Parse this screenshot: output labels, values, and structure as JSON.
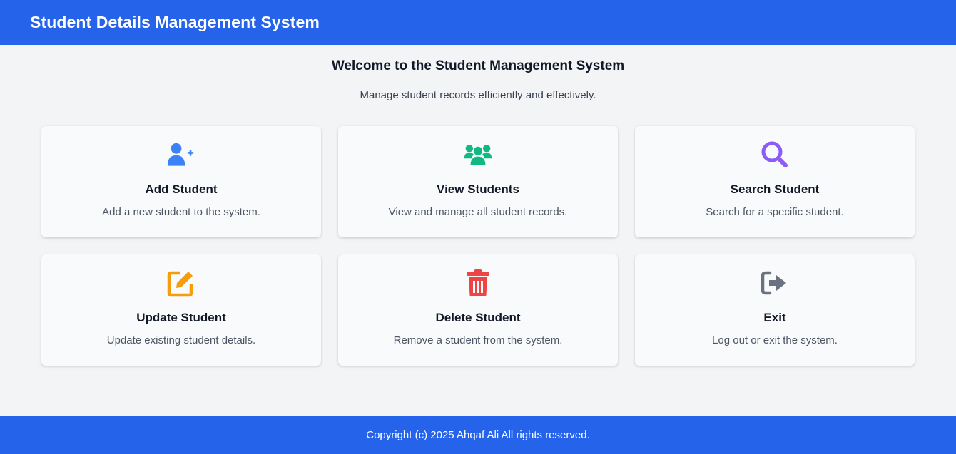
{
  "header": {
    "title": "Student Details Management System"
  },
  "welcome": {
    "title": "Welcome to the Student Management System",
    "subtitle": "Manage student records efficiently and effectively."
  },
  "cards": [
    {
      "title": "Add Student",
      "description": "Add a new student to the system.",
      "icon": "user-plus-icon",
      "color": "#3b82f6"
    },
    {
      "title": "View Students",
      "description": "View and manage all student records.",
      "icon": "users-icon",
      "color": "#10b981"
    },
    {
      "title": "Search Student",
      "description": "Search for a specific student.",
      "icon": "search-icon",
      "color": "#8b5cf6"
    },
    {
      "title": "Update Student",
      "description": "Update existing student details.",
      "icon": "edit-icon",
      "color": "#f59e0b"
    },
    {
      "title": "Delete Student",
      "description": "Remove a student from the system.",
      "icon": "trash-icon",
      "color": "#ef4444"
    },
    {
      "title": "Exit",
      "description": "Log out or exit the system.",
      "icon": "sign-out-icon",
      "color": "#6b7280"
    }
  ],
  "footer": {
    "text": "Copyright (c) 2025 Ahqaf Ali All rights reserved."
  },
  "colors": {
    "brand": "#2563eb",
    "background": "#f3f4f6",
    "card": "#f9fafb"
  }
}
